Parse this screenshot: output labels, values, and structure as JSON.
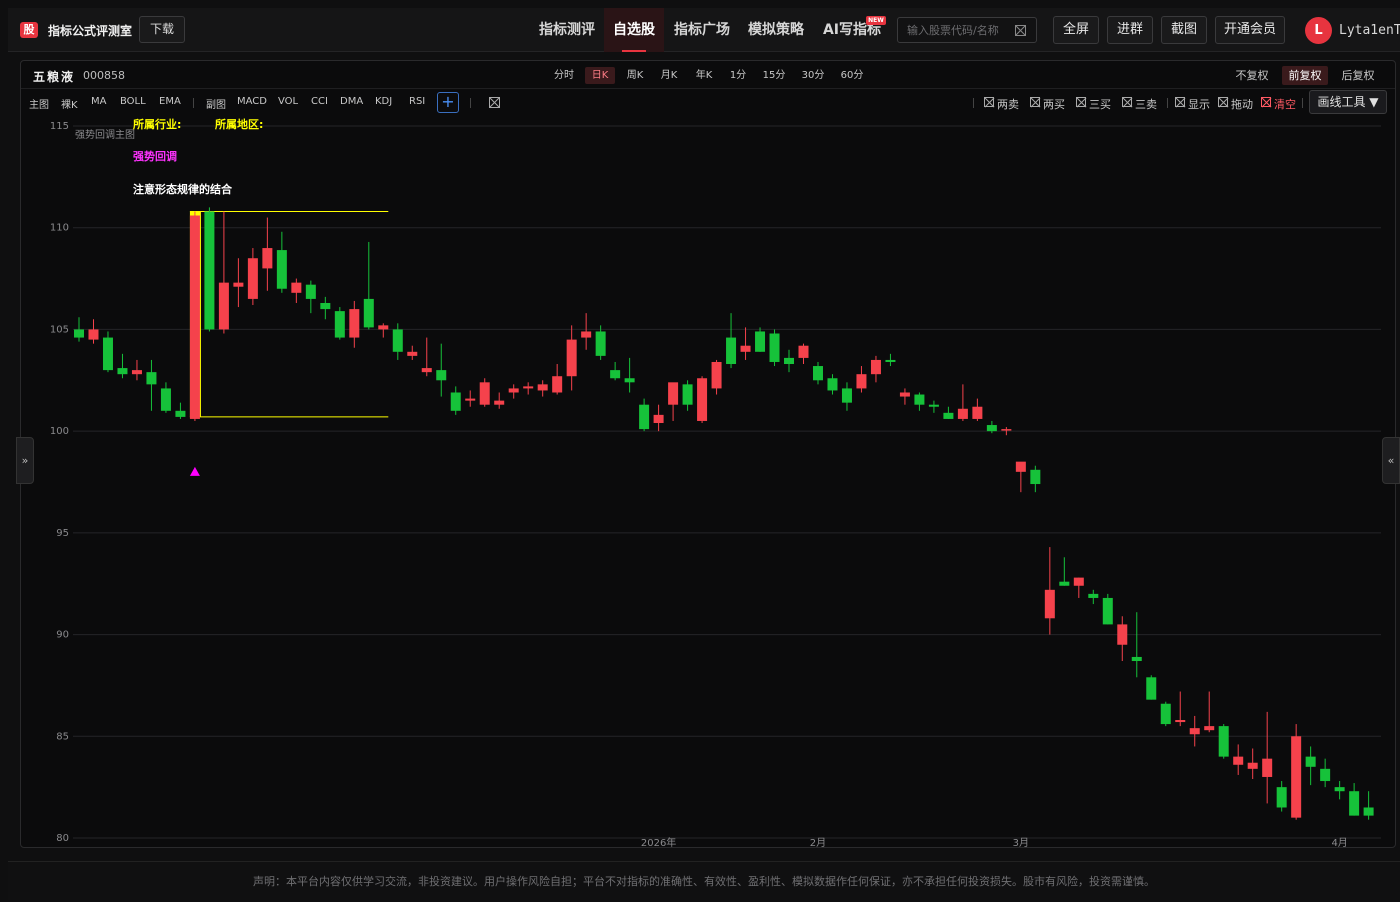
{
  "header": {
    "logo_char": "股",
    "app_name": "指标公式评测室",
    "download_label": "下载",
    "nav": [
      "指标测评",
      "自选股",
      "指标广场",
      "模拟策略",
      "AI写指标"
    ],
    "nav_active": "自选股",
    "new_tag": "NEW",
    "search_placeholder": "输入股票代码/名称",
    "buttons": [
      "全屏",
      "进群",
      "截图",
      "开通会员"
    ],
    "avatar_letter": "L",
    "username": "Lyta1enT"
  },
  "stock": {
    "name": "五粮液",
    "code": "000858"
  },
  "periods": [
    "分时",
    "日K",
    "周K",
    "月K",
    "年K",
    "1分",
    "15分",
    "30分",
    "60分"
  ],
  "active_period": "日K",
  "adjust": [
    "不复权",
    "前复权",
    "后复权"
  ],
  "active_adjust": "前复权",
  "indicators": {
    "main_label": "主图",
    "main": [
      "裸K",
      "MA",
      "BOLL",
      "EMA"
    ],
    "sub_label": "副图",
    "sub": [
      "MACD",
      "VOL",
      "CCI",
      "DMA",
      "KDJ",
      "RSI"
    ]
  },
  "signal_toggles": [
    "两卖",
    "两买",
    "三买",
    "三卖"
  ],
  "display_toggles": [
    "显示",
    "拖动",
    "清空"
  ],
  "draw_tool_label": "画线工具 ▼",
  "sidebar_tabs": {
    "left": "»",
    "right": "«"
  },
  "footer_text": "声明：本平台内容仅供学习交流，非投资建议。用户操作风险自担；平台不对指标的准确性、有效性、盈利性、模拟数据作任何保证，亦不承担任何投资损失。股市有风险，投资需谨慎。",
  "colors": {
    "up": "#f5424c",
    "down": "#16c23a",
    "accent": "#e7343f",
    "highlight": "#ffff00",
    "marker": "#ff00ff"
  },
  "chart_data": {
    "type": "candlestick",
    "indicator_name": "强势回调主图",
    "annotations": {
      "industry_label": "所属行业:",
      "region_label": "所属地区:",
      "pattern_label": "强势回调",
      "note": "注意形态规律的结合"
    },
    "ylim": [
      80,
      115
    ],
    "y_ticks": [
      80,
      85,
      90,
      95,
      100,
      105,
      110,
      115
    ],
    "x_labels": [
      {
        "index": 40,
        "label": "2026年"
      },
      {
        "index": 51,
        "label": "2月"
      },
      {
        "index": 65,
        "label": "3月"
      },
      {
        "index": 87,
        "label": "4月"
      }
    ],
    "highlight_box": {
      "start_index": 8,
      "end_index": 21,
      "high": 110.8,
      "low": 100.7
    },
    "signal_marker": {
      "index": 8,
      "price": 98.0
    },
    "candles": [
      {
        "o": 105.0,
        "h": 105.6,
        "l": 104.4,
        "c": 104.6
      },
      {
        "o": 104.5,
        "h": 105.5,
        "l": 104.3,
        "c": 105.0
      },
      {
        "o": 104.6,
        "h": 104.9,
        "l": 102.9,
        "c": 103.0
      },
      {
        "o": 103.1,
        "h": 103.8,
        "l": 102.6,
        "c": 102.8
      },
      {
        "o": 102.8,
        "h": 103.5,
        "l": 102.5,
        "c": 103.0
      },
      {
        "o": 102.9,
        "h": 103.5,
        "l": 101.0,
        "c": 102.3
      },
      {
        "o": 102.1,
        "h": 102.4,
        "l": 100.9,
        "c": 101.0
      },
      {
        "o": 101.0,
        "h": 101.4,
        "l": 100.6,
        "c": 100.7
      },
      {
        "o": 100.6,
        "h": 110.8,
        "l": 100.5,
        "c": 110.6
      },
      {
        "o": 110.8,
        "h": 111.0,
        "l": 104.9,
        "c": 105.0
      },
      {
        "o": 105.0,
        "h": 110.8,
        "l": 104.8,
        "c": 107.3
      },
      {
        "o": 107.1,
        "h": 108.5,
        "l": 106.1,
        "c": 107.3
      },
      {
        "o": 106.5,
        "h": 109.0,
        "l": 106.2,
        "c": 108.5
      },
      {
        "o": 108.0,
        "h": 110.5,
        "l": 106.9,
        "c": 109.0
      },
      {
        "o": 108.9,
        "h": 109.8,
        "l": 106.8,
        "c": 107.0
      },
      {
        "o": 106.8,
        "h": 107.5,
        "l": 106.3,
        "c": 107.3
      },
      {
        "o": 107.2,
        "h": 107.4,
        "l": 105.8,
        "c": 106.5
      },
      {
        "o": 106.3,
        "h": 106.6,
        "l": 105.5,
        "c": 106.0
      },
      {
        "o": 105.9,
        "h": 106.1,
        "l": 104.5,
        "c": 104.6
      },
      {
        "o": 104.6,
        "h": 106.4,
        "l": 104.1,
        "c": 106.0
      },
      {
        "o": 106.5,
        "h": 109.3,
        "l": 105.0,
        "c": 105.1
      },
      {
        "o": 105.0,
        "h": 105.3,
        "l": 104.6,
        "c": 105.2
      },
      {
        "o": 105.0,
        "h": 105.3,
        "l": 103.5,
        "c": 103.9
      },
      {
        "o": 103.7,
        "h": 104.2,
        "l": 103.5,
        "c": 103.9
      },
      {
        "o": 102.9,
        "h": 104.6,
        "l": 102.7,
        "c": 103.1
      },
      {
        "o": 103.0,
        "h": 104.3,
        "l": 101.7,
        "c": 102.5
      },
      {
        "o": 101.9,
        "h": 102.2,
        "l": 100.8,
        "c": 101.0
      },
      {
        "o": 101.5,
        "h": 102.0,
        "l": 101.2,
        "c": 101.6
      },
      {
        "o": 101.3,
        "h": 102.6,
        "l": 101.2,
        "c": 102.4
      },
      {
        "o": 101.3,
        "h": 101.9,
        "l": 101.1,
        "c": 101.5
      },
      {
        "o": 101.9,
        "h": 102.3,
        "l": 101.6,
        "c": 102.1
      },
      {
        "o": 102.1,
        "h": 102.4,
        "l": 101.8,
        "c": 102.2
      },
      {
        "o": 102.0,
        "h": 102.5,
        "l": 101.7,
        "c": 102.3
      },
      {
        "o": 101.9,
        "h": 103.3,
        "l": 101.8,
        "c": 102.7
      },
      {
        "o": 102.7,
        "h": 105.2,
        "l": 102.0,
        "c": 104.5
      },
      {
        "o": 104.6,
        "h": 105.8,
        "l": 104.0,
        "c": 104.9
      },
      {
        "o": 104.9,
        "h": 105.2,
        "l": 103.5,
        "c": 103.7
      },
      {
        "o": 103.0,
        "h": 103.4,
        "l": 102.5,
        "c": 102.6
      },
      {
        "o": 102.6,
        "h": 103.6,
        "l": 101.9,
        "c": 102.4
      },
      {
        "o": 101.3,
        "h": 101.6,
        "l": 100.0,
        "c": 100.1
      },
      {
        "o": 100.4,
        "h": 101.3,
        "l": 100.0,
        "c": 100.8
      },
      {
        "o": 101.3,
        "h": 102.2,
        "l": 100.5,
        "c": 102.4
      },
      {
        "o": 102.3,
        "h": 102.5,
        "l": 101.0,
        "c": 101.3
      },
      {
        "o": 100.5,
        "h": 102.7,
        "l": 100.4,
        "c": 102.6
      },
      {
        "o": 102.1,
        "h": 103.5,
        "l": 101.8,
        "c": 103.4
      },
      {
        "o": 104.6,
        "h": 105.8,
        "l": 103.1,
        "c": 103.3
      },
      {
        "o": 103.9,
        "h": 105.1,
        "l": 103.5,
        "c": 104.2
      },
      {
        "o": 104.9,
        "h": 105.1,
        "l": 103.9,
        "c": 103.9
      },
      {
        "o": 104.8,
        "h": 105.0,
        "l": 103.2,
        "c": 103.4
      },
      {
        "o": 103.6,
        "h": 104.0,
        "l": 102.9,
        "c": 103.3
      },
      {
        "o": 103.6,
        "h": 104.3,
        "l": 103.3,
        "c": 104.2
      },
      {
        "o": 103.2,
        "h": 103.4,
        "l": 102.3,
        "c": 102.5
      },
      {
        "o": 102.6,
        "h": 102.8,
        "l": 101.8,
        "c": 102.0
      },
      {
        "o": 102.1,
        "h": 102.4,
        "l": 101.0,
        "c": 101.4
      },
      {
        "o": 102.1,
        "h": 103.2,
        "l": 101.9,
        "c": 102.8
      },
      {
        "o": 102.8,
        "h": 103.7,
        "l": 102.4,
        "c": 103.5
      },
      {
        "o": 103.5,
        "h": 103.8,
        "l": 103.2,
        "c": 103.4
      },
      {
        "o": 101.7,
        "h": 102.1,
        "l": 101.3,
        "c": 101.9
      },
      {
        "o": 101.8,
        "h": 101.9,
        "l": 101.0,
        "c": 101.3
      },
      {
        "o": 101.3,
        "h": 101.5,
        "l": 100.9,
        "c": 101.2
      },
      {
        "o": 100.9,
        "h": 101.2,
        "l": 100.6,
        "c": 100.6
      },
      {
        "o": 100.6,
        "h": 102.3,
        "l": 100.5,
        "c": 101.1
      },
      {
        "o": 100.6,
        "h": 101.6,
        "l": 100.5,
        "c": 101.2
      },
      {
        "o": 100.3,
        "h": 100.5,
        "l": 99.9,
        "c": 100.0
      },
      {
        "o": 100.1,
        "h": 100.2,
        "l": 99.8,
        "c": 100.1
      },
      {
        "o": 98.0,
        "h": 98.3,
        "l": 97.0,
        "c": 98.5
      },
      {
        "o": 98.1,
        "h": 98.3,
        "l": 97.0,
        "c": 97.4
      },
      {
        "o": 90.8,
        "h": 94.3,
        "l": 90.0,
        "c": 92.2
      },
      {
        "o": 92.6,
        "h": 93.8,
        "l": 92.4,
        "c": 92.4
      },
      {
        "o": 92.4,
        "h": 92.8,
        "l": 91.8,
        "c": 92.8
      },
      {
        "o": 92.0,
        "h": 92.2,
        "l": 91.5,
        "c": 91.8
      },
      {
        "o": 91.8,
        "h": 92.0,
        "l": 90.5,
        "c": 90.5
      },
      {
        "o": 89.5,
        "h": 90.9,
        "l": 88.7,
        "c": 90.5
      },
      {
        "o": 88.9,
        "h": 91.1,
        "l": 87.9,
        "c": 88.7
      },
      {
        "o": 87.9,
        "h": 88.0,
        "l": 86.8,
        "c": 86.8
      },
      {
        "o": 86.6,
        "h": 86.7,
        "l": 85.5,
        "c": 85.6
      },
      {
        "o": 85.7,
        "h": 87.2,
        "l": 85.5,
        "c": 85.8
      },
      {
        "o": 85.1,
        "h": 86.0,
        "l": 84.5,
        "c": 85.4
      },
      {
        "o": 85.3,
        "h": 87.2,
        "l": 85.2,
        "c": 85.5
      },
      {
        "o": 85.5,
        "h": 85.6,
        "l": 83.9,
        "c": 84.0
      },
      {
        "o": 83.6,
        "h": 84.6,
        "l": 83.1,
        "c": 84.0
      },
      {
        "o": 83.4,
        "h": 84.4,
        "l": 82.9,
        "c": 83.7
      },
      {
        "o": 83.0,
        "h": 86.2,
        "l": 81.7,
        "c": 83.9
      },
      {
        "o": 82.5,
        "h": 82.8,
        "l": 81.3,
        "c": 81.5
      },
      {
        "o": 81.0,
        "h": 85.6,
        "l": 80.9,
        "c": 85.0
      },
      {
        "o": 84.0,
        "h": 84.5,
        "l": 82.6,
        "c": 83.5
      },
      {
        "o": 83.4,
        "h": 83.9,
        "l": 82.5,
        "c": 82.8
      },
      {
        "o": 82.5,
        "h": 82.8,
        "l": 81.9,
        "c": 82.3
      },
      {
        "o": 82.3,
        "h": 82.7,
        "l": 81.1,
        "c": 81.1
      },
      {
        "o": 81.5,
        "h": 82.3,
        "l": 80.9,
        "c": 81.1
      }
    ]
  }
}
